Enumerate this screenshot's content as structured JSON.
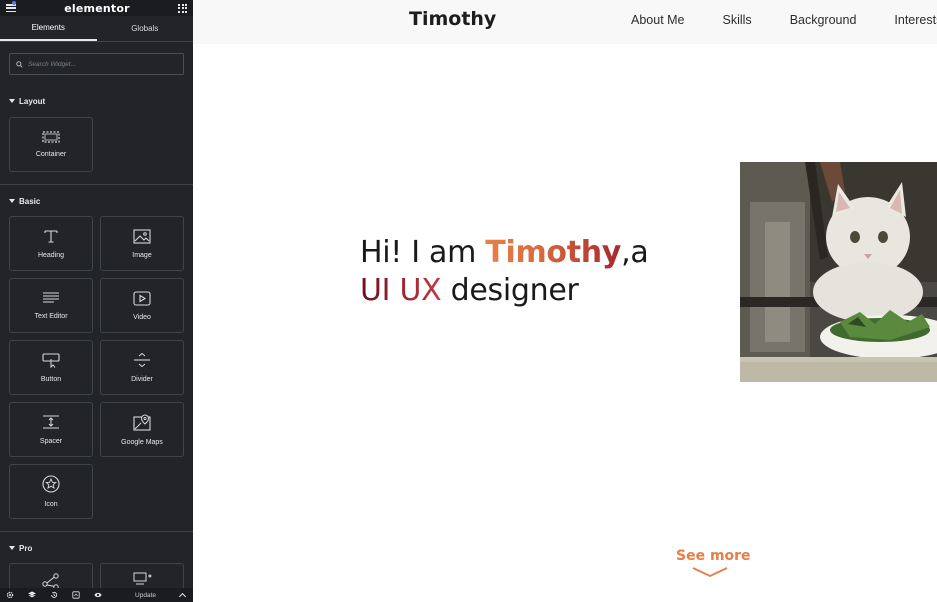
{
  "sidebar": {
    "logo": "elementor",
    "tabs": [
      {
        "label": "Elements",
        "active": true
      },
      {
        "label": "Globals",
        "active": false
      }
    ],
    "search": {
      "placeholder": "Search Widget..."
    },
    "sections": {
      "layout": {
        "title": "Layout",
        "widgets": [
          {
            "label": "Container",
            "icon": "container-icon"
          }
        ]
      },
      "basic": {
        "title": "Basic",
        "widgets": [
          {
            "label": "Heading",
            "icon": "heading-icon"
          },
          {
            "label": "Image",
            "icon": "image-icon"
          },
          {
            "label": "Text Editor",
            "icon": "text-editor-icon"
          },
          {
            "label": "Video",
            "icon": "video-icon"
          },
          {
            "label": "Button",
            "icon": "button-icon"
          },
          {
            "label": "Divider",
            "icon": "divider-icon"
          },
          {
            "label": "Spacer",
            "icon": "spacer-icon"
          },
          {
            "label": "Google Maps",
            "icon": "google-maps-icon"
          },
          {
            "label": "Icon",
            "icon": "star-icon"
          }
        ]
      },
      "pro": {
        "title": "Pro",
        "widgets": [
          {
            "label": "",
            "icon": "share-icon"
          },
          {
            "label": "",
            "icon": "form-icon"
          }
        ]
      }
    },
    "footer": {
      "icons": [
        "settings-icon",
        "navigator-icon",
        "history-icon",
        "responsive-icon",
        "preview-icon"
      ],
      "update_label": "Update"
    }
  },
  "site": {
    "brand": "Timothy",
    "nav": [
      "About Me",
      "Skills",
      "Background",
      "Interests"
    ],
    "hero": {
      "line1_prefix": "Hi! I am ",
      "name": "Timothy",
      "line1_suffix": ",a",
      "role": "UI UX",
      "line2_suffix": " designer"
    },
    "see_more": "See more"
  },
  "colors": {
    "sidebar_bg": "#232428",
    "accent_orange": "#e8804a",
    "accent_red": "#a8262f",
    "header_bg": "#f8f8f8"
  }
}
